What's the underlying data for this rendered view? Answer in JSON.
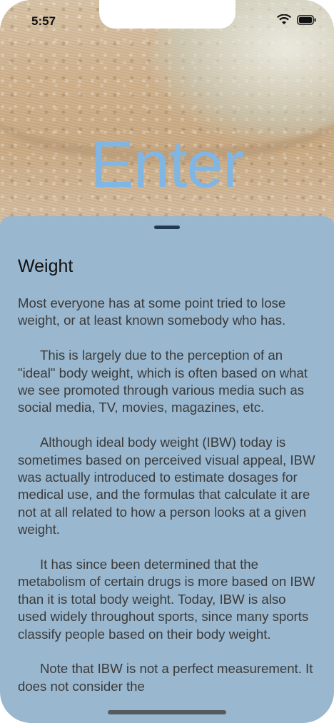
{
  "status_bar": {
    "time": "5:57",
    "icons": [
      "wifi-icon",
      "battery-icon"
    ]
  },
  "hero": {
    "title": "Enter"
  },
  "sheet": {
    "title": "Weight",
    "paragraphs": [
      "Most everyone has at some point tried to lose weight, or at least known somebody who has.",
      "This is largely due to the perception of an \"ideal\" body weight, which is often based on what we see promoted through various media such as social media, TV, movies, magazines, etc.",
      "Although ideal body weight (IBW) today is sometimes based on perceived visual appeal, IBW was actually introduced to estimate dosages for medical use, and the formulas that calculate it are not at all related to how a person looks at a given weight.",
      "It has since been determined that the metabolism of certain drugs is more based on IBW than it is total body weight. Today, IBW is also used widely throughout sports, since many sports classify people based on their body weight.",
      "Note that IBW is not a perfect measurement. It does not consider the"
    ]
  },
  "colors": {
    "title_blue": "#80b6e3",
    "sheet_background": "#99b7ce",
    "text": "#3a3a3a"
  }
}
